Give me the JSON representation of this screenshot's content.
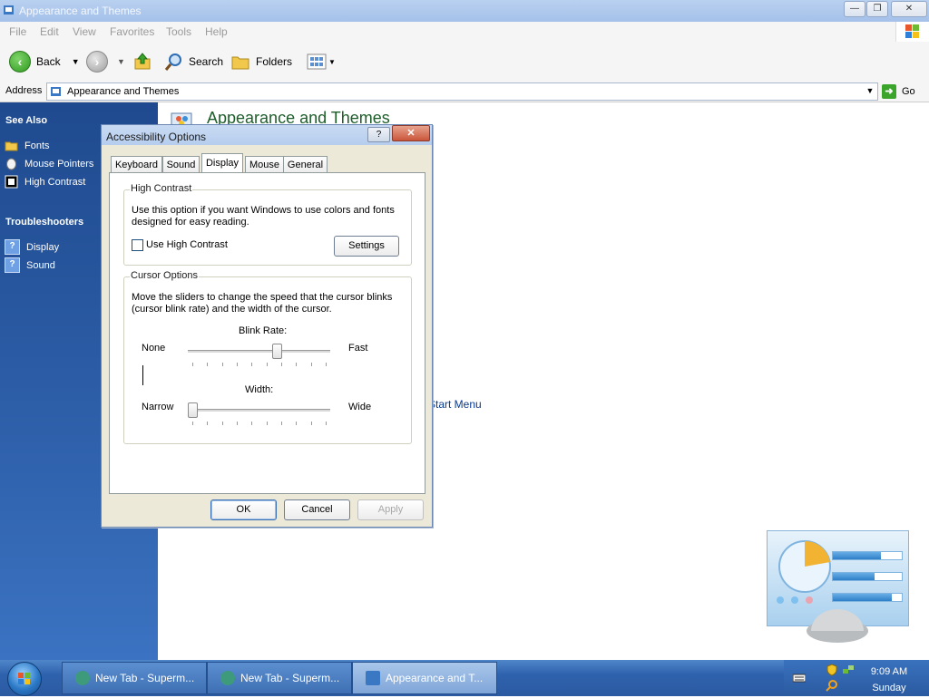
{
  "window": {
    "title": "Appearance and Themes"
  },
  "menu": [
    "File",
    "Edit",
    "View",
    "Favorites",
    "Tools",
    "Help"
  ],
  "toolbar": {
    "back": "Back",
    "search": "Search",
    "folders": "Folders"
  },
  "address": {
    "label": "Address",
    "value": "Appearance and Themes",
    "go": "Go"
  },
  "sidebar": {
    "see_also": "See Also",
    "see_also_items": [
      {
        "label": "Fonts"
      },
      {
        "label": "Mouse Pointers"
      },
      {
        "label": "High Contrast"
      }
    ],
    "troubleshooters": "Troubleshooters",
    "troubleshooter_items": [
      {
        "label": "Display"
      },
      {
        "label": "Sound"
      }
    ]
  },
  "main": {
    "title": "Appearance and Themes",
    "link_partial": "Start Menu"
  },
  "dialog": {
    "title": "Accessibility Options",
    "tabs": [
      {
        "label": "Keyboard",
        "active": false
      },
      {
        "label": "Sound",
        "active": false
      },
      {
        "label": "Display",
        "active": true
      },
      {
        "label": "Mouse",
        "active": false
      },
      {
        "label": "General",
        "active": false
      }
    ],
    "high_contrast": {
      "title": "High Contrast",
      "desc": "Use this option if you want Windows to use colors and fonts designed for easy reading.",
      "checkbox": "Use High Contrast",
      "checked": false,
      "settings": "Settings"
    },
    "cursor_options": {
      "title": "Cursor Options",
      "desc": "Move the sliders to change the speed that the cursor blinks (cursor blink rate) and the width of the cursor.",
      "blink_label": "Blink Rate:",
      "blink_min": "None",
      "blink_max": "Fast",
      "blink_value": 0.63,
      "width_label": "Width:",
      "width_min": "Narrow",
      "width_max": "Wide",
      "width_value": 0.0
    },
    "buttons": {
      "ok": "OK",
      "cancel": "Cancel",
      "apply": "Apply"
    }
  },
  "taskbar": {
    "tasks": [
      {
        "label": "New Tab - Superm...",
        "active": false
      },
      {
        "label": "New Tab - Superm...",
        "active": false
      },
      {
        "label": "Appearance and T...",
        "active": true
      }
    ],
    "time": "9:09 AM",
    "day": "Sunday"
  },
  "colors": {
    "sidebar": "#2d5ea8",
    "title_green": "#1d5e2a",
    "link": "#0a3a8c"
  }
}
